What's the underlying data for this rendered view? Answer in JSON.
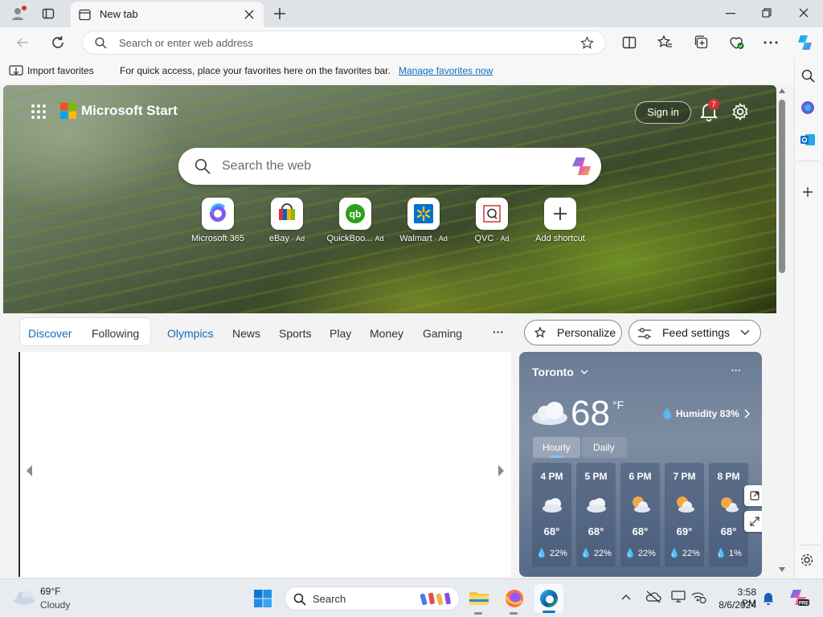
{
  "browser": {
    "tab_title": "New tab",
    "address_placeholder": "Search or enter web address",
    "favorites": {
      "import_label": "Import favorites",
      "message": "For quick access, place your favorites here on the favorites bar.",
      "manage_link": "Manage favorites now"
    }
  },
  "start": {
    "brand": "Microsoft Start",
    "sign_in": "Sign in",
    "notification_count": "7",
    "search_placeholder": "Search the web",
    "shortcuts": [
      {
        "label": "Microsoft 365",
        "ad": ""
      },
      {
        "label": "eBay",
        "ad": "· Ad"
      },
      {
        "label": "QuickBoo...",
        "ad": "Ad"
      },
      {
        "label": "Walmart",
        "ad": "· Ad"
      },
      {
        "label": "QVC",
        "ad": "· Ad"
      },
      {
        "label": "Add shortcut",
        "ad": ""
      }
    ],
    "feed_tabs": [
      "Discover",
      "Following",
      "Olympics",
      "News",
      "Sports",
      "Play",
      "Money",
      "Gaming"
    ],
    "more": "···",
    "personalize": "Personalize",
    "feed_settings": "Feed settings"
  },
  "weather": {
    "city": "Toronto",
    "temp": "68",
    "unit": "°F",
    "humidity": "Humidity 83%",
    "tab_hourly": "Hourly",
    "tab_daily": "Daily",
    "more": "···",
    "hours": [
      {
        "time": "4 PM",
        "temp": "68°",
        "precip": "22%"
      },
      {
        "time": "5 PM",
        "temp": "68°",
        "precip": "22%"
      },
      {
        "time": "6 PM",
        "temp": "68°",
        "precip": "22%"
      },
      {
        "time": "7 PM",
        "temp": "69°",
        "precip": "22%"
      },
      {
        "time": "8 PM",
        "temp": "68°",
        "precip": "1%"
      }
    ]
  },
  "taskbar": {
    "weather_temp": "69°F",
    "weather_desc": "Cloudy",
    "search_label": "Search",
    "time": "3:58 PM",
    "date": "8/6/2024"
  },
  "colors": {
    "accent": "#0f6cbd",
    "notification_badge": "#d13438"
  }
}
